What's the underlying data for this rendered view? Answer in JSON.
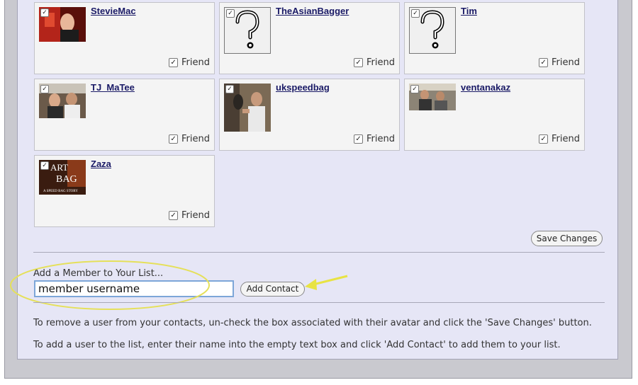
{
  "members": [
    {
      "username": "StevieMac",
      "friend_label": "Friend",
      "avatar_icon": "photo-red-icon"
    },
    {
      "username": "TheAsianBagger",
      "friend_label": "Friend",
      "avatar_icon": "question-mark-placeholder-icon"
    },
    {
      "username": "Tim",
      "friend_label": "Friend",
      "avatar_icon": "question-mark-placeholder-icon"
    },
    {
      "username": "TJ_MaTee",
      "friend_label": "Friend",
      "avatar_icon": "photo-people-icon"
    },
    {
      "username": "ukspeedbag",
      "friend_label": "Friend",
      "avatar_icon": "photo-man-icon"
    },
    {
      "username": "ventanakaz",
      "friend_label": "Friend",
      "avatar_icon": "photo-people-icon"
    },
    {
      "username": "Zaza",
      "friend_label": "Friend",
      "avatar_icon": "art-of-the-bag-logo-icon",
      "avatar_text_line1": "ART",
      "avatar_text_line2": "BAG",
      "avatar_subtitle": "A SPEED BAG STORY"
    }
  ],
  "save_button_label": "Save Changes",
  "add_member": {
    "label": "Add a Member to Your List...",
    "input_value": "member username",
    "button_label": "Add Contact"
  },
  "help_text": {
    "remove": "To remove a user from your contacts, un-check the box associated with their avatar and click the 'Save Changes' button.",
    "add": "To add a user to the list, enter their name into the empty text box and click 'Add Contact' to add them to your list."
  },
  "colors": {
    "panel_bg": "#e6e6f6",
    "link": "#1a1a66",
    "highlight_ellipse": "#e5e05a",
    "annotation_arrow": "#e8e344",
    "input_border": "#7da6d8"
  }
}
